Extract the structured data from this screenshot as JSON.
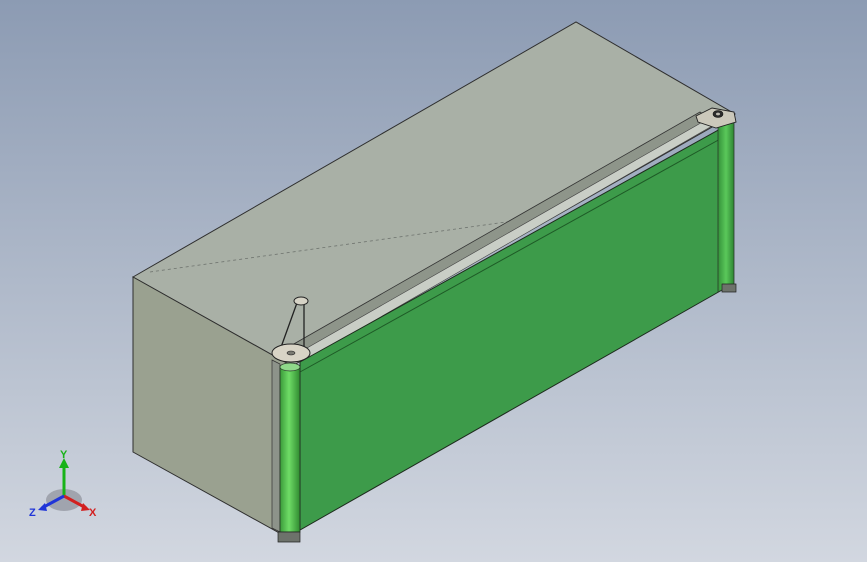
{
  "viewport": {
    "background_top": "#8c9bb3",
    "background_bottom": "#d2d7e0"
  },
  "model": {
    "frame_top_color": "#a9b0a6",
    "frame_side_color": "#9aa190",
    "panel_color": "#3d9b4a",
    "roller_color": "#55c253"
  },
  "triad": {
    "y_label": "Y",
    "x_label": "X",
    "z_label": "Z",
    "y_color": "#18b318",
    "x_color": "#d22020",
    "z_color": "#2035d8"
  }
}
